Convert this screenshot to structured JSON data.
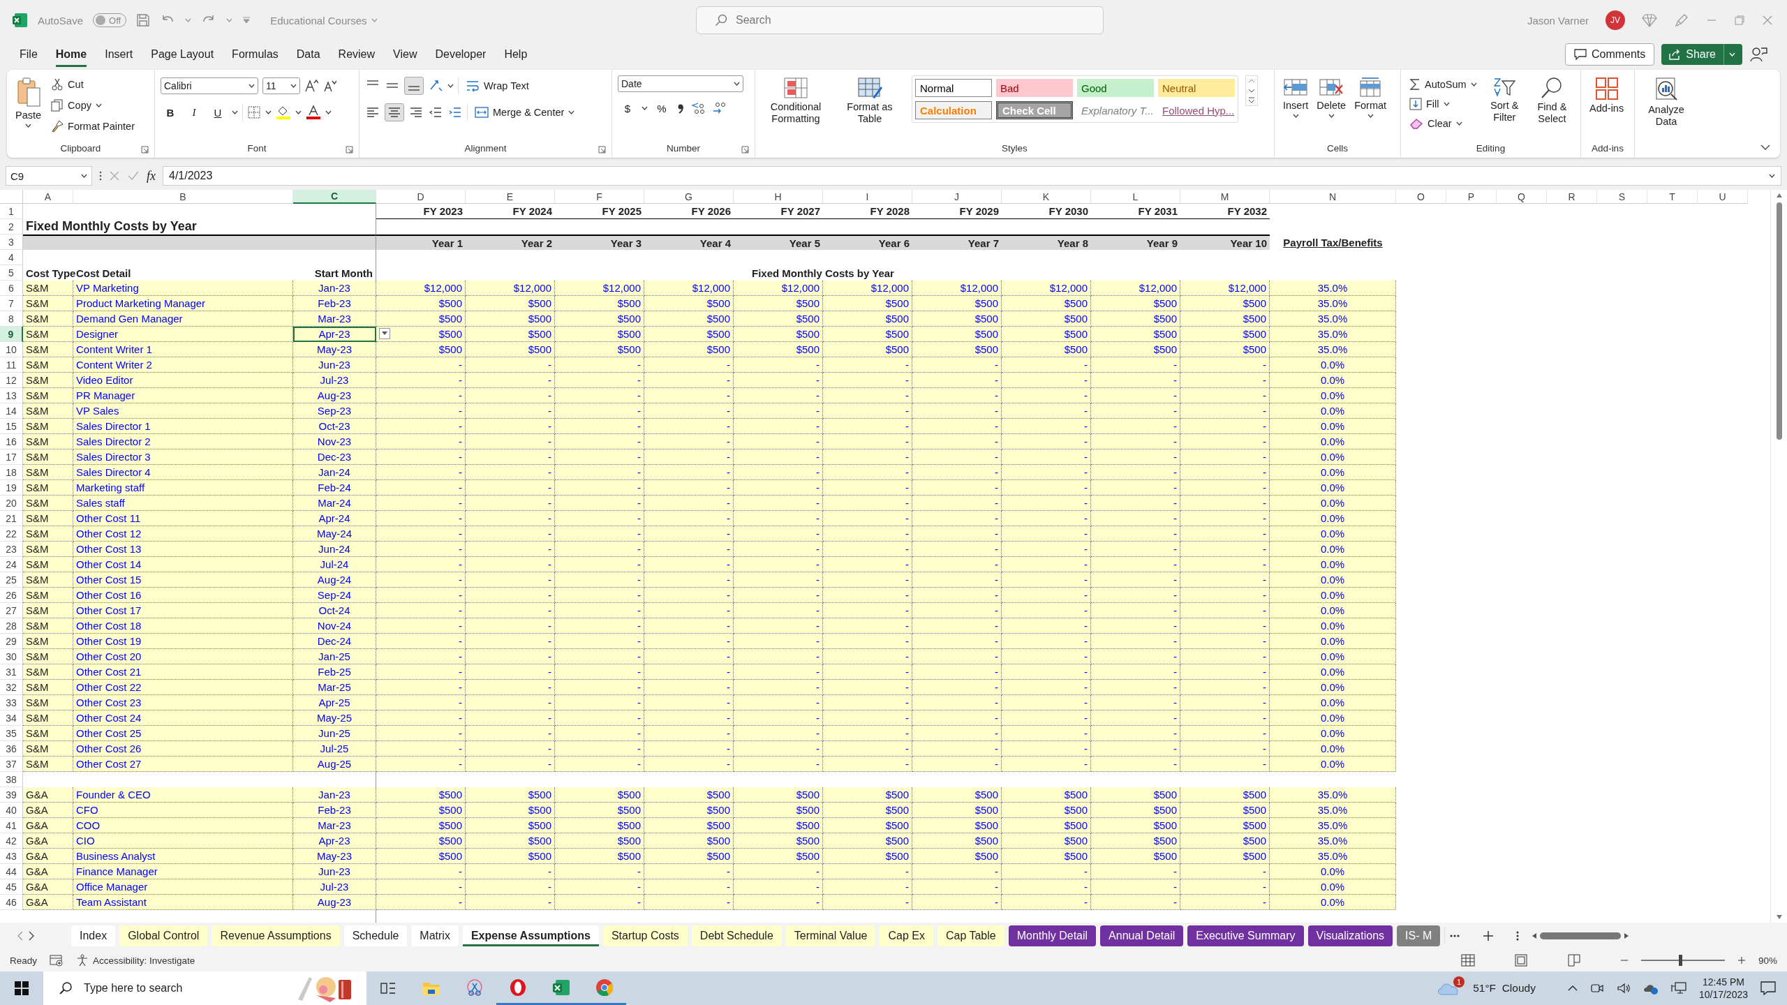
{
  "title_bar": {
    "autosave_label": "AutoSave",
    "autosave_on": false,
    "autosave_state": "Off",
    "document": "Educational Courses",
    "search_placeholder": "Search",
    "user": "Jason Varner",
    "avatar": "JV"
  },
  "menu": {
    "tabs": [
      {
        "label": "File",
        "selected": false
      },
      {
        "label": "Home",
        "selected": true
      },
      {
        "label": "Insert",
        "selected": false
      },
      {
        "label": "Page Layout",
        "selected": false
      },
      {
        "label": "Formulas",
        "selected": false
      },
      {
        "label": "Data",
        "selected": false
      },
      {
        "label": "Review",
        "selected": false
      },
      {
        "label": "View",
        "selected": false
      },
      {
        "label": "Developer",
        "selected": false
      },
      {
        "label": "Help",
        "selected": false
      }
    ],
    "comments": "Comments",
    "share": "Share"
  },
  "ribbon": {
    "clipboard": {
      "label": "Clipboard",
      "paste": "Paste",
      "cut": "Cut",
      "copy": "Copy",
      "format_painter": "Format Painter"
    },
    "font": {
      "label": "Font",
      "name": "Calibri",
      "size": "11",
      "styles": [
        "B",
        "I",
        "U"
      ]
    },
    "alignment": {
      "label": "Alignment",
      "wrap_text": "Wrap Text",
      "merge_center": "Merge & Center"
    },
    "number": {
      "label": "Number",
      "format": "Date",
      "currency": "$",
      "percent": "%"
    },
    "styles": {
      "label": "Styles",
      "conditional": "Conditional Formatting",
      "format_table": "Format as Table",
      "gallery": [
        {
          "label": "Normal",
          "kind": "normal"
        },
        {
          "label": "Bad",
          "kind": "bad"
        },
        {
          "label": "Good",
          "kind": "good"
        },
        {
          "label": "Neutral",
          "kind": "neutral"
        },
        {
          "label": "Calculation",
          "kind": "calculation"
        },
        {
          "label": "Check Cell",
          "kind": "check"
        },
        {
          "label": "Explanatory T...",
          "kind": "explanatory"
        },
        {
          "label": "Followed Hyp...",
          "kind": "followed"
        }
      ]
    },
    "cells": {
      "label": "Cells",
      "insert": "Insert",
      "delete": "Delete",
      "format": "Format"
    },
    "editing": {
      "label": "Editing",
      "autosum": "AutoSum",
      "fill": "Fill",
      "clear": "Clear",
      "sort": "Sort & Filter",
      "find": "Find & Select"
    },
    "addins": {
      "label": "Add-ins",
      "button": "Add-ins"
    },
    "analyze": {
      "button": "Analyze Data"
    }
  },
  "formula_bar": {
    "name_box": "C9",
    "function_label": "fx",
    "formula": "4/1/2023"
  },
  "sheet": {
    "columns": [
      {
        "label": "A",
        "selected": false
      },
      {
        "label": "B",
        "selected": false
      },
      {
        "label": "C",
        "selected": true
      },
      {
        "label": "D",
        "selected": false
      },
      {
        "label": "E",
        "selected": false
      },
      {
        "label": "F",
        "selected": false
      },
      {
        "label": "G",
        "selected": false
      },
      {
        "label": "H",
        "selected": false
      },
      {
        "label": "I",
        "selected": false
      },
      {
        "label": "J",
        "selected": false
      },
      {
        "label": "K",
        "selected": false
      },
      {
        "label": "L",
        "selected": false
      },
      {
        "label": "M",
        "selected": false
      },
      {
        "label": "N",
        "selected": false
      },
      {
        "label": "O",
        "selected": false
      },
      {
        "label": "P",
        "selected": false
      },
      {
        "label": "Q",
        "selected": false
      },
      {
        "label": "R",
        "selected": false
      },
      {
        "label": "S",
        "selected": false
      },
      {
        "label": "T",
        "selected": false
      },
      {
        "label": "U",
        "selected": false
      }
    ],
    "rows": [
      {
        "kind": "fy",
        "number": "1",
        "selected": false,
        "fiscal_years": [
          "FY 2023",
          "FY 2024",
          "FY 2025",
          "FY 2026",
          "FY 2027",
          "FY 2028",
          "FY 2029",
          "FY 2030",
          "FY 2031",
          "FY 2032"
        ]
      },
      {
        "kind": "title",
        "number": "2",
        "selected": false,
        "title": "Fixed Monthly Costs by Year"
      },
      {
        "kind": "years",
        "number": "3",
        "selected": false,
        "years": [
          "Year 1",
          "Year 2",
          "Year 3",
          "Year 4",
          "Year 5",
          "Year 6",
          "Year 7",
          "Year 8",
          "Year 9",
          "Year 10"
        ],
        "payroll_heading": "Payroll Tax/Benefits"
      },
      {
        "kind": "blank",
        "number": "4",
        "selected": false
      },
      {
        "kind": "labels",
        "number": "5",
        "selected": false,
        "cost_type": "Cost Type",
        "cost_detail": "Cost Detail",
        "start_month": "Start Month",
        "values_heading": "Fixed Monthly Costs by Year"
      },
      {
        "kind": "data",
        "number": "6",
        "selected": false,
        "cost_type": "S&M",
        "cost_detail": "VP Marketing",
        "start_month": "Jan-23",
        "values": [
          "$12,000",
          "$12,000",
          "$12,000",
          "$12,000",
          "$12,000",
          "$12,000",
          "$12,000",
          "$12,000",
          "$12,000",
          "$12,000"
        ],
        "payroll": "35.0%"
      },
      {
        "kind": "data",
        "number": "7",
        "selected": false,
        "cost_type": "S&M",
        "cost_detail": "Product Marketing Manager",
        "start_month": "Feb-23",
        "values": [
          "$500",
          "$500",
          "$500",
          "$500",
          "$500",
          "$500",
          "$500",
          "$500",
          "$500",
          "$500"
        ],
        "payroll": "35.0%"
      },
      {
        "kind": "data",
        "number": "8",
        "selected": false,
        "cost_type": "S&M",
        "cost_detail": "Demand Gen Manager",
        "start_month": "Mar-23",
        "values": [
          "$500",
          "$500",
          "$500",
          "$500",
          "$500",
          "$500",
          "$500",
          "$500",
          "$500",
          "$500"
        ],
        "payroll": "35.0%"
      },
      {
        "kind": "data",
        "number": "9",
        "selected": true,
        "cost_type": "S&M",
        "cost_detail": "Designer",
        "start_month": "Apr-23",
        "values": [
          "$500",
          "$500",
          "$500",
          "$500",
          "$500",
          "$500",
          "$500",
          "$500",
          "$500",
          "$500"
        ],
        "payroll": "35.0%"
      },
      {
        "kind": "data",
        "number": "10",
        "selected": false,
        "cost_type": "S&M",
        "cost_detail": "Content Writer 1",
        "start_month": "May-23",
        "values": [
          "$500",
          "$500",
          "$500",
          "$500",
          "$500",
          "$500",
          "$500",
          "$500",
          "$500",
          "$500"
        ],
        "payroll": "35.0%"
      },
      {
        "kind": "data",
        "number": "11",
        "selected": false,
        "cost_type": "S&M",
        "cost_detail": "Content Writer 2",
        "start_month": "Jun-23",
        "values": [
          "-",
          "-",
          "-",
          "-",
          "-",
          "-",
          "-",
          "-",
          "-",
          "-"
        ],
        "payroll": "0.0%"
      },
      {
        "kind": "data",
        "number": "12",
        "selected": false,
        "cost_type": "S&M",
        "cost_detail": "Video Editor",
        "start_month": "Jul-23",
        "values": [
          "-",
          "-",
          "-",
          "-",
          "-",
          "-",
          "-",
          "-",
          "-",
          "-"
        ],
        "payroll": "0.0%"
      },
      {
        "kind": "data",
        "number": "13",
        "selected": false,
        "cost_type": "S&M",
        "cost_detail": "PR Manager",
        "start_month": "Aug-23",
        "values": [
          "-",
          "-",
          "-",
          "-",
          "-",
          "-",
          "-",
          "-",
          "-",
          "-"
        ],
        "payroll": "0.0%"
      },
      {
        "kind": "data",
        "number": "14",
        "selected": false,
        "cost_type": "S&M",
        "cost_detail": "VP Sales",
        "start_month": "Sep-23",
        "values": [
          "-",
          "-",
          "-",
          "-",
          "-",
          "-",
          "-",
          "-",
          "-",
          "-"
        ],
        "payroll": "0.0%"
      },
      {
        "kind": "data",
        "number": "15",
        "selected": false,
        "cost_type": "S&M",
        "cost_detail": "Sales Director 1",
        "start_month": "Oct-23",
        "values": [
          "-",
          "-",
          "-",
          "-",
          "-",
          "-",
          "-",
          "-",
          "-",
          "-"
        ],
        "payroll": "0.0%"
      },
      {
        "kind": "data",
        "number": "16",
        "selected": false,
        "cost_type": "S&M",
        "cost_detail": "Sales Director 2",
        "start_month": "Nov-23",
        "values": [
          "-",
          "-",
          "-",
          "-",
          "-",
          "-",
          "-",
          "-",
          "-",
          "-"
        ],
        "payroll": "0.0%"
      },
      {
        "kind": "data",
        "number": "17",
        "selected": false,
        "cost_type": "S&M",
        "cost_detail": "Sales Director 3",
        "start_month": "Dec-23",
        "values": [
          "-",
          "-",
          "-",
          "-",
          "-",
          "-",
          "-",
          "-",
          "-",
          "-"
        ],
        "payroll": "0.0%"
      },
      {
        "kind": "data",
        "number": "18",
        "selected": false,
        "cost_type": "S&M",
        "cost_detail": "Sales Director 4",
        "start_month": "Jan-24",
        "values": [
          "-",
          "-",
          "-",
          "-",
          "-",
          "-",
          "-",
          "-",
          "-",
          "-"
        ],
        "payroll": "0.0%"
      },
      {
        "kind": "data",
        "number": "19",
        "selected": false,
        "cost_type": "S&M",
        "cost_detail": "Marketing staff",
        "start_month": "Feb-24",
        "values": [
          "-",
          "-",
          "-",
          "-",
          "-",
          "-",
          "-",
          "-",
          "-",
          "-"
        ],
        "payroll": "0.0%"
      },
      {
        "kind": "data",
        "number": "20",
        "selected": false,
        "cost_type": "S&M",
        "cost_detail": "Sales staff",
        "start_month": "Mar-24",
        "values": [
          "-",
          "-",
          "-",
          "-",
          "-",
          "-",
          "-",
          "-",
          "-",
          "-"
        ],
        "payroll": "0.0%"
      },
      {
        "kind": "data",
        "number": "21",
        "selected": false,
        "cost_type": "S&M",
        "cost_detail": "Other Cost 11",
        "start_month": "Apr-24",
        "values": [
          "-",
          "-",
          "-",
          "-",
          "-",
          "-",
          "-",
          "-",
          "-",
          "-"
        ],
        "payroll": "0.0%"
      },
      {
        "kind": "data",
        "number": "22",
        "selected": false,
        "cost_type": "S&M",
        "cost_detail": "Other Cost 12",
        "start_month": "May-24",
        "values": [
          "-",
          "-",
          "-",
          "-",
          "-",
          "-",
          "-",
          "-",
          "-",
          "-"
        ],
        "payroll": "0.0%"
      },
      {
        "kind": "data",
        "number": "23",
        "selected": false,
        "cost_type": "S&M",
        "cost_detail": "Other Cost 13",
        "start_month": "Jun-24",
        "values": [
          "-",
          "-",
          "-",
          "-",
          "-",
          "-",
          "-",
          "-",
          "-",
          "-"
        ],
        "payroll": "0.0%"
      },
      {
        "kind": "data",
        "number": "24",
        "selected": false,
        "cost_type": "S&M",
        "cost_detail": "Other Cost 14",
        "start_month": "Jul-24",
        "values": [
          "-",
          "-",
          "-",
          "-",
          "-",
          "-",
          "-",
          "-",
          "-",
          "-"
        ],
        "payroll": "0.0%"
      },
      {
        "kind": "data",
        "number": "25",
        "selected": false,
        "cost_type": "S&M",
        "cost_detail": "Other Cost 15",
        "start_month": "Aug-24",
        "values": [
          "-",
          "-",
          "-",
          "-",
          "-",
          "-",
          "-",
          "-",
          "-",
          "-"
        ],
        "payroll": "0.0%"
      },
      {
        "kind": "data",
        "number": "26",
        "selected": false,
        "cost_type": "S&M",
        "cost_detail": "Other Cost 16",
        "start_month": "Sep-24",
        "values": [
          "-",
          "-",
          "-",
          "-",
          "-",
          "-",
          "-",
          "-",
          "-",
          "-"
        ],
        "payroll": "0.0%"
      },
      {
        "kind": "data",
        "number": "27",
        "selected": false,
        "cost_type": "S&M",
        "cost_detail": "Other Cost 17",
        "start_month": "Oct-24",
        "values": [
          "-",
          "-",
          "-",
          "-",
          "-",
          "-",
          "-",
          "-",
          "-",
          "-"
        ],
        "payroll": "0.0%"
      },
      {
        "kind": "data",
        "number": "28",
        "selected": false,
        "cost_type": "S&M",
        "cost_detail": "Other Cost 18",
        "start_month": "Nov-24",
        "values": [
          "-",
          "-",
          "-",
          "-",
          "-",
          "-",
          "-",
          "-",
          "-",
          "-"
        ],
        "payroll": "0.0%"
      },
      {
        "kind": "data",
        "number": "29",
        "selected": false,
        "cost_type": "S&M",
        "cost_detail": "Other Cost 19",
        "start_month": "Dec-24",
        "values": [
          "-",
          "-",
          "-",
          "-",
          "-",
          "-",
          "-",
          "-",
          "-",
          "-"
        ],
        "payroll": "0.0%"
      },
      {
        "kind": "data",
        "number": "30",
        "selected": false,
        "cost_type": "S&M",
        "cost_detail": "Other Cost 20",
        "start_month": "Jan-25",
        "values": [
          "-",
          "-",
          "-",
          "-",
          "-",
          "-",
          "-",
          "-",
          "-",
          "-"
        ],
        "payroll": "0.0%"
      },
      {
        "kind": "data",
        "number": "31",
        "selected": false,
        "cost_type": "S&M",
        "cost_detail": "Other Cost 21",
        "start_month": "Feb-25",
        "values": [
          "-",
          "-",
          "-",
          "-",
          "-",
          "-",
          "-",
          "-",
          "-",
          "-"
        ],
        "payroll": "0.0%"
      },
      {
        "kind": "data",
        "number": "32",
        "selected": false,
        "cost_type": "S&M",
        "cost_detail": "Other Cost 22",
        "start_month": "Mar-25",
        "values": [
          "-",
          "-",
          "-",
          "-",
          "-",
          "-",
          "-",
          "-",
          "-",
          "-"
        ],
        "payroll": "0.0%"
      },
      {
        "kind": "data",
        "number": "33",
        "selected": false,
        "cost_type": "S&M",
        "cost_detail": "Other Cost 23",
        "start_month": "Apr-25",
        "values": [
          "-",
          "-",
          "-",
          "-",
          "-",
          "-",
          "-",
          "-",
          "-",
          "-"
        ],
        "payroll": "0.0%"
      },
      {
        "kind": "data",
        "number": "34",
        "selected": false,
        "cost_type": "S&M",
        "cost_detail": "Other Cost 24",
        "start_month": "May-25",
        "values": [
          "-",
          "-",
          "-",
          "-",
          "-",
          "-",
          "-",
          "-",
          "-",
          "-"
        ],
        "payroll": "0.0%"
      },
      {
        "kind": "data",
        "number": "35",
        "selected": false,
        "cost_type": "S&M",
        "cost_detail": "Other Cost 25",
        "start_month": "Jun-25",
        "values": [
          "-",
          "-",
          "-",
          "-",
          "-",
          "-",
          "-",
          "-",
          "-",
          "-"
        ],
        "payroll": "0.0%"
      },
      {
        "kind": "data",
        "number": "36",
        "selected": false,
        "cost_type": "S&M",
        "cost_detail": "Other Cost 26",
        "start_month": "Jul-25",
        "values": [
          "-",
          "-",
          "-",
          "-",
          "-",
          "-",
          "-",
          "-",
          "-",
          "-"
        ],
        "payroll": "0.0%"
      },
      {
        "kind": "data",
        "number": "37",
        "selected": false,
        "cost_type": "S&M",
        "cost_detail": "Other Cost 27",
        "start_month": "Aug-25",
        "values": [
          "-",
          "-",
          "-",
          "-",
          "-",
          "-",
          "-",
          "-",
          "-",
          "-"
        ],
        "payroll": "0.0%"
      },
      {
        "kind": "blank",
        "number": "38",
        "selected": false
      },
      {
        "kind": "data",
        "number": "39",
        "selected": false,
        "cost_type": "G&A",
        "cost_detail": "Founder & CEO",
        "start_month": "Jan-23",
        "values": [
          "$500",
          "$500",
          "$500",
          "$500",
          "$500",
          "$500",
          "$500",
          "$500",
          "$500",
          "$500"
        ],
        "payroll": "35.0%"
      },
      {
        "kind": "data",
        "number": "40",
        "selected": false,
        "cost_type": "G&A",
        "cost_detail": "CFO",
        "start_month": "Feb-23",
        "values": [
          "$500",
          "$500",
          "$500",
          "$500",
          "$500",
          "$500",
          "$500",
          "$500",
          "$500",
          "$500"
        ],
        "payroll": "35.0%"
      },
      {
        "kind": "data",
        "number": "41",
        "selected": false,
        "cost_type": "G&A",
        "cost_detail": "COO",
        "start_month": "Mar-23",
        "values": [
          "$500",
          "$500",
          "$500",
          "$500",
          "$500",
          "$500",
          "$500",
          "$500",
          "$500",
          "$500"
        ],
        "payroll": "35.0%"
      },
      {
        "kind": "data",
        "number": "42",
        "selected": false,
        "cost_type": "G&A",
        "cost_detail": "CIO",
        "start_month": "Apr-23",
        "values": [
          "$500",
          "$500",
          "$500",
          "$500",
          "$500",
          "$500",
          "$500",
          "$500",
          "$500",
          "$500"
        ],
        "payroll": "35.0%"
      },
      {
        "kind": "data",
        "number": "43",
        "selected": false,
        "cost_type": "G&A",
        "cost_detail": "Business Analyst",
        "start_month": "May-23",
        "values": [
          "$500",
          "$500",
          "$500",
          "$500",
          "$500",
          "$500",
          "$500",
          "$500",
          "$500",
          "$500"
        ],
        "payroll": "35.0%"
      },
      {
        "kind": "data",
        "number": "44",
        "selected": false,
        "cost_type": "G&A",
        "cost_detail": "Finance Manager",
        "start_month": "Jun-23",
        "values": [
          "-",
          "-",
          "-",
          "-",
          "-",
          "-",
          "-",
          "-",
          "-",
          "-"
        ],
        "payroll": "0.0%"
      },
      {
        "kind": "data",
        "number": "45",
        "selected": false,
        "cost_type": "G&A",
        "cost_detail": "Office Manager",
        "start_month": "Jul-23",
        "values": [
          "-",
          "-",
          "-",
          "-",
          "-",
          "-",
          "-",
          "-",
          "-",
          "-"
        ],
        "payroll": "0.0%"
      },
      {
        "kind": "data",
        "number": "46",
        "selected": false,
        "cost_type": "G&A",
        "cost_detail": "Team Assistant",
        "start_month": "Aug-23",
        "values": [
          "-",
          "-",
          "-",
          "-",
          "-",
          "-",
          "-",
          "-",
          "-",
          "-"
        ],
        "payroll": "0.0%"
      }
    ]
  },
  "sheet_tabs": [
    {
      "label": "Index",
      "selected": false,
      "color": "#ffffff"
    },
    {
      "label": "Global Control",
      "selected": false,
      "color": "#ffffcc"
    },
    {
      "label": "Revenue Assumptions",
      "selected": false,
      "color": "#ffffcc"
    },
    {
      "label": "Schedule",
      "selected": false,
      "color": "#ffffff"
    },
    {
      "label": "Matrix",
      "selected": false,
      "color": "#ffffff"
    },
    {
      "label": "Expense Assumptions",
      "selected": true,
      "color": "#ffffff"
    },
    {
      "label": "Startup Costs",
      "selected": false,
      "color": "#ffffcc"
    },
    {
      "label": "Debt Schedule",
      "selected": false,
      "color": "#ffffcc"
    },
    {
      "label": "Terminal Value",
      "selected": false,
      "color": "#ffffcc"
    },
    {
      "label": "Cap Ex",
      "selected": false,
      "color": "#ffffcc"
    },
    {
      "label": "Cap Table",
      "selected": false,
      "color": "#ffffcc"
    },
    {
      "label": "Monthly Detail",
      "selected": false,
      "color": "#7030a0"
    },
    {
      "label": "Annual Detail",
      "selected": false,
      "color": "#7030a0"
    },
    {
      "label": "Executive Summary",
      "selected": false,
      "color": "#7030a0"
    },
    {
      "label": "Visualizations",
      "selected": false,
      "color": "#7030a0"
    },
    {
      "label": "IS- M",
      "selected": false,
      "color": "#808080"
    }
  ],
  "status_bar": {
    "ready": "Ready",
    "accessibility": "Accessibility: Investigate",
    "zoom_slider": {
      "level": 0.47
    },
    "zoom": "90%"
  },
  "taskbar": {
    "search_placeholder": "Type here to search",
    "apps": [
      {
        "kind": "taskview",
        "running": false
      },
      {
        "kind": "folder",
        "running": false
      },
      {
        "kind": "snip",
        "running": false
      },
      {
        "kind": "opera",
        "running": true
      },
      {
        "kind": "excel",
        "running": true
      },
      {
        "kind": "chrome",
        "running": true
      }
    ],
    "weather_badge": "1",
    "weather": "51°F  Cloudy",
    "time": "12:45 PM",
    "date": "10/17/2023"
  }
}
